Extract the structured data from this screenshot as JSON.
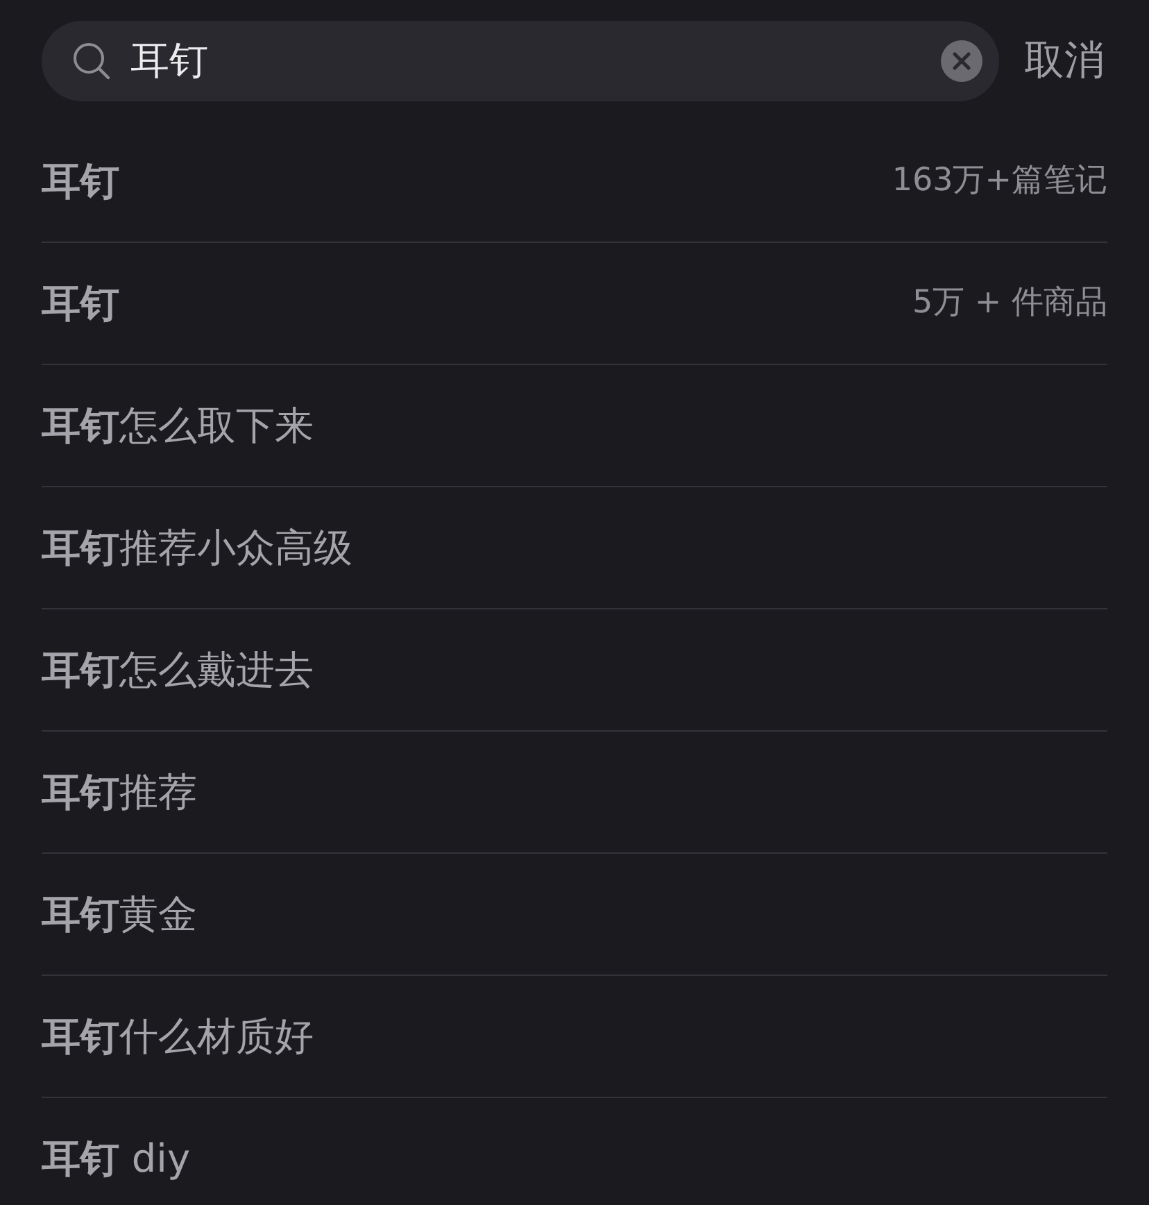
{
  "search": {
    "value": "耳钉",
    "cancel": "取消"
  },
  "suggestions": [
    {
      "text": "**耳钉**",
      "count": "163万+篇笔记"
    },
    {
      "text": "**耳钉**",
      "count": "5万 + 件商品"
    },
    {
      "text": "**耳钉**怎么取下来"
    },
    {
      "text": "**耳钉**推荐小众高级"
    },
    {
      "text": "**耳钉**怎么戴进去"
    },
    {
      "text": "**耳钉**推荐"
    },
    {
      "text": "**耳钉**黄金"
    },
    {
      "text": "**耳钉**什么材质好"
    },
    {
      "text": "**耳钉** diy"
    }
  ]
}
